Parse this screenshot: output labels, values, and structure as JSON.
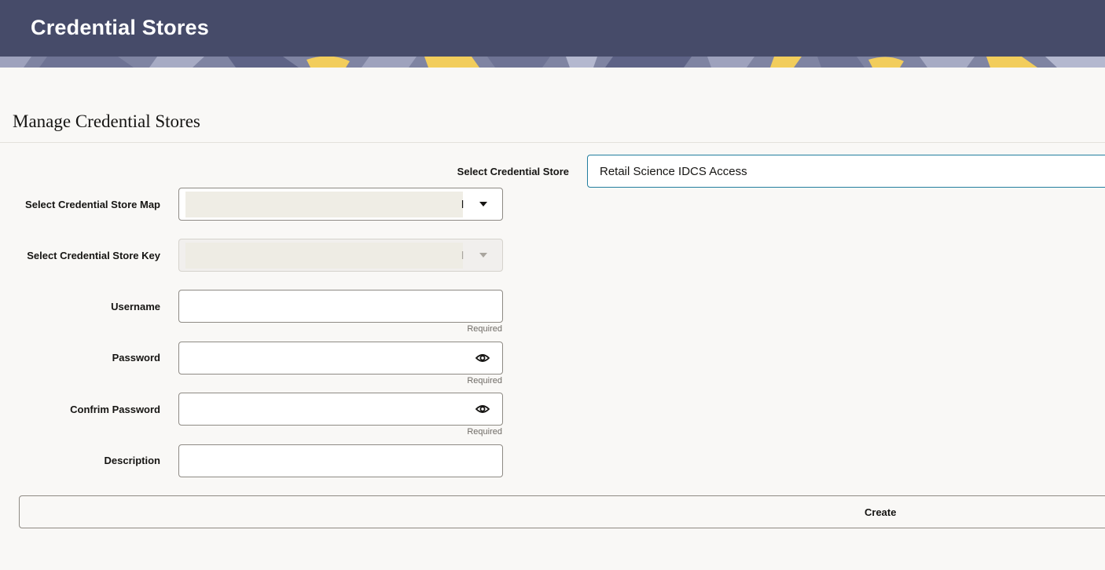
{
  "header": {
    "title": "Credential Stores"
  },
  "page": {
    "title": "Manage Credential Stores"
  },
  "form": {
    "credential_store": {
      "label": "Select Credential Store",
      "value": "Retail Science IDCS Access"
    },
    "store_map": {
      "label": "Select Credential Store Map",
      "visible_tail": "l"
    },
    "store_key": {
      "label": "Select Credential Store Key",
      "visible_tail": "l"
    },
    "username": {
      "label": "Username",
      "value": "",
      "hint": "Required"
    },
    "password": {
      "label": "Password",
      "value": "",
      "hint": "Required"
    },
    "confirm_password": {
      "label": "Confrim Password",
      "value": "",
      "hint": "Required"
    },
    "description": {
      "label": "Description",
      "value": ""
    },
    "create_label": "Create"
  },
  "colors": {
    "header_bg": "#464b69",
    "focus_border": "#227e9e",
    "page_bg": "#f9f8f6"
  },
  "icons": {
    "password_toggle": "eye-icon",
    "dropdown": "chevron-down-icon"
  }
}
